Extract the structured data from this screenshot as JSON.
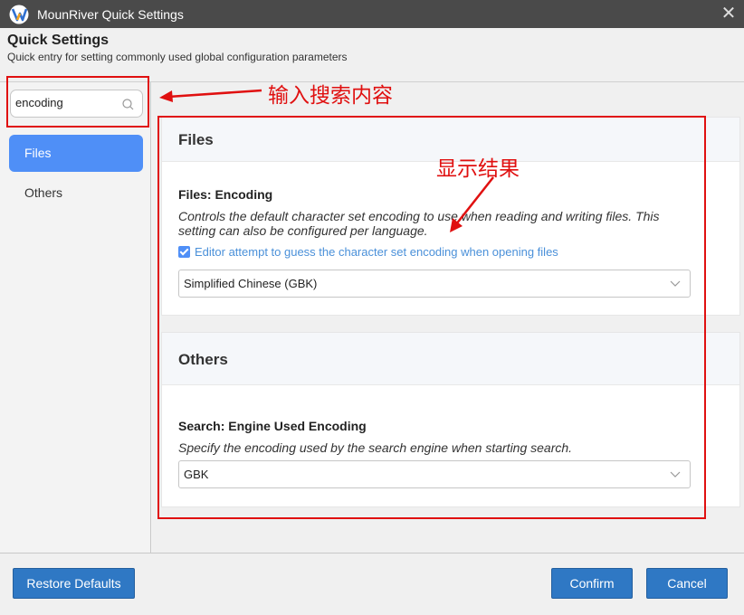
{
  "window": {
    "title": "MounRiver Quick Settings",
    "close_icon": "close-icon",
    "logo_icon": "mounriver-logo-icon"
  },
  "header": {
    "title": "Quick Settings",
    "subtitle": "Quick entry for setting commonly used global configuration parameters"
  },
  "sidebar": {
    "search": {
      "value": "encoding",
      "icon": "search-icon"
    },
    "items": [
      {
        "label": "Files",
        "active": true
      },
      {
        "label": "Others",
        "active": false
      }
    ]
  },
  "sections": [
    {
      "title": "Files",
      "setting_title": "Files: Encoding",
      "description": "Controls the default character set encoding to use when reading and writing files. This setting can also be configured per language.",
      "checkbox": {
        "label": "Editor attempt to guess the character set encoding when opening files",
        "checked": true
      },
      "dropdown": {
        "value": "Simplified Chinese (GBK)",
        "icon": "chevron-down-icon"
      }
    },
    {
      "title": "Others",
      "setting_title": "Search: Engine Used Encoding",
      "description": "Specify the encoding used by the search engine when starting search.",
      "dropdown": {
        "value": "GBK",
        "icon": "chevron-down-icon"
      }
    }
  ],
  "footer": {
    "restore_label": "Restore Defaults",
    "confirm_label": "Confirm",
    "cancel_label": "Cancel"
  },
  "annotations": {
    "search_note": "输入搜索内容",
    "result_note": "显示结果",
    "color": "#e01010"
  },
  "colors": {
    "accent": "#4f8ff7",
    "button": "#2f78c4",
    "titlebar": "#4a4a4a"
  }
}
